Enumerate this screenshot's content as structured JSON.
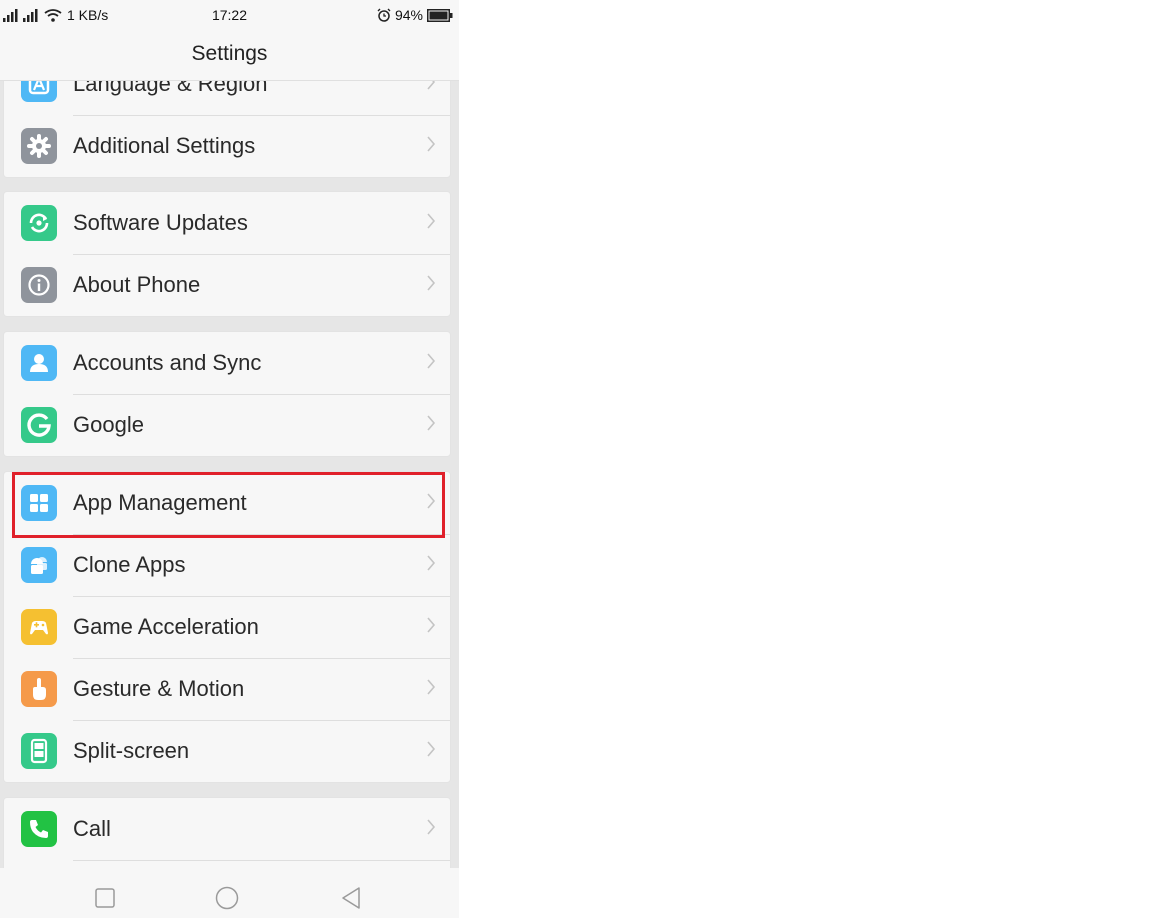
{
  "status_bar": {
    "network_speed": "1 KB/s",
    "time": "17:22",
    "battery": "94%",
    "icons": [
      "signal-icon",
      "signal-icon",
      "wifi-icon",
      "alarm-icon",
      "battery-icon"
    ]
  },
  "header": {
    "title": "Settings"
  },
  "groups": [
    {
      "items": [
        {
          "label": "Language & Region",
          "icon": "language-icon",
          "color": "#4fb8f5"
        },
        {
          "label": "Additional Settings",
          "icon": "gear-icon",
          "color": "#8f949c"
        }
      ]
    },
    {
      "items": [
        {
          "label": "Software Updates",
          "icon": "update-icon",
          "color": "#35c98a"
        },
        {
          "label": "About Phone",
          "icon": "info-icon",
          "color": "#8f949c"
        }
      ]
    },
    {
      "items": [
        {
          "label": "Accounts and Sync",
          "icon": "account-icon",
          "color": "#4fb8f5"
        },
        {
          "label": "Google",
          "icon": "google-icon",
          "color": "#35c98a"
        }
      ]
    },
    {
      "items": [
        {
          "label": "App Management",
          "icon": "app-management-icon",
          "color": "#4fb8f5"
        },
        {
          "label": "Clone Apps",
          "icon": "clone-apps-icon",
          "color": "#4fb8f5"
        },
        {
          "label": "Game Acceleration",
          "icon": "game-icon",
          "color": "#f5c031"
        },
        {
          "label": "Gesture & Motion",
          "icon": "gesture-icon",
          "color": "#f59a4a"
        },
        {
          "label": "Split-screen",
          "icon": "split-screen-icon",
          "color": "#35c98a"
        }
      ]
    },
    {
      "items": [
        {
          "label": "Call",
          "icon": "phone-icon",
          "color": "#22c244"
        }
      ]
    }
  ],
  "nav_bar": {
    "buttons": [
      "recents-icon",
      "home-icon",
      "back-icon"
    ]
  },
  "highlight": {
    "target": "App Management",
    "color": "#e0202a"
  }
}
